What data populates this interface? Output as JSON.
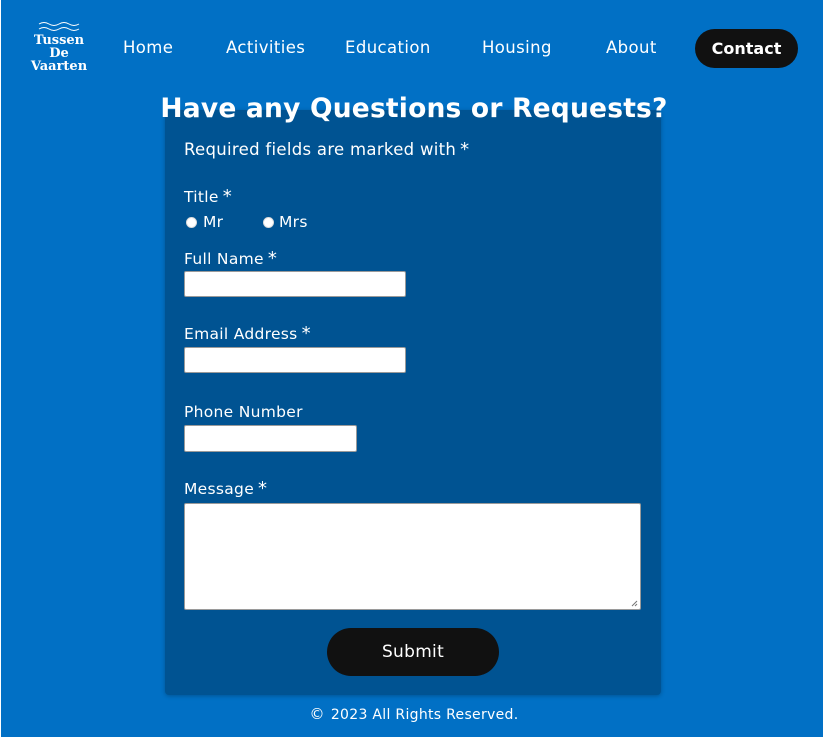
{
  "header": {
    "logo_line1": "Tussen De",
    "logo_line2": "Vaarten",
    "nav": {
      "home": "Home",
      "activities": "Activities",
      "education": "Education",
      "housing": "Housing",
      "about": "About",
      "contact": "Contact"
    }
  },
  "form": {
    "title": "Have any Questions or Requests?",
    "required_note": "Required fields are marked with",
    "asterisk": "*",
    "title_label": "Title",
    "title_options": {
      "mr": "Mr",
      "mrs": "Mrs"
    },
    "full_name_label": "Full Name",
    "full_name_value": "",
    "email_label": "Email Address",
    "email_value": "",
    "phone_label": "Phone Number",
    "phone_value": "",
    "message_label": "Message",
    "message_value": "",
    "submit_label": "Submit"
  },
  "footer": {
    "copyright_symbol": "©",
    "text": "2023 All Rights Reserved."
  },
  "colors": {
    "background": "#0170c5",
    "card": "#005392",
    "button": "#111111",
    "text": "#ffffff"
  },
  "icons": [
    "waves-icon",
    "radio-empty-icon",
    "resize-grip-icon",
    "copyright-icon"
  ]
}
